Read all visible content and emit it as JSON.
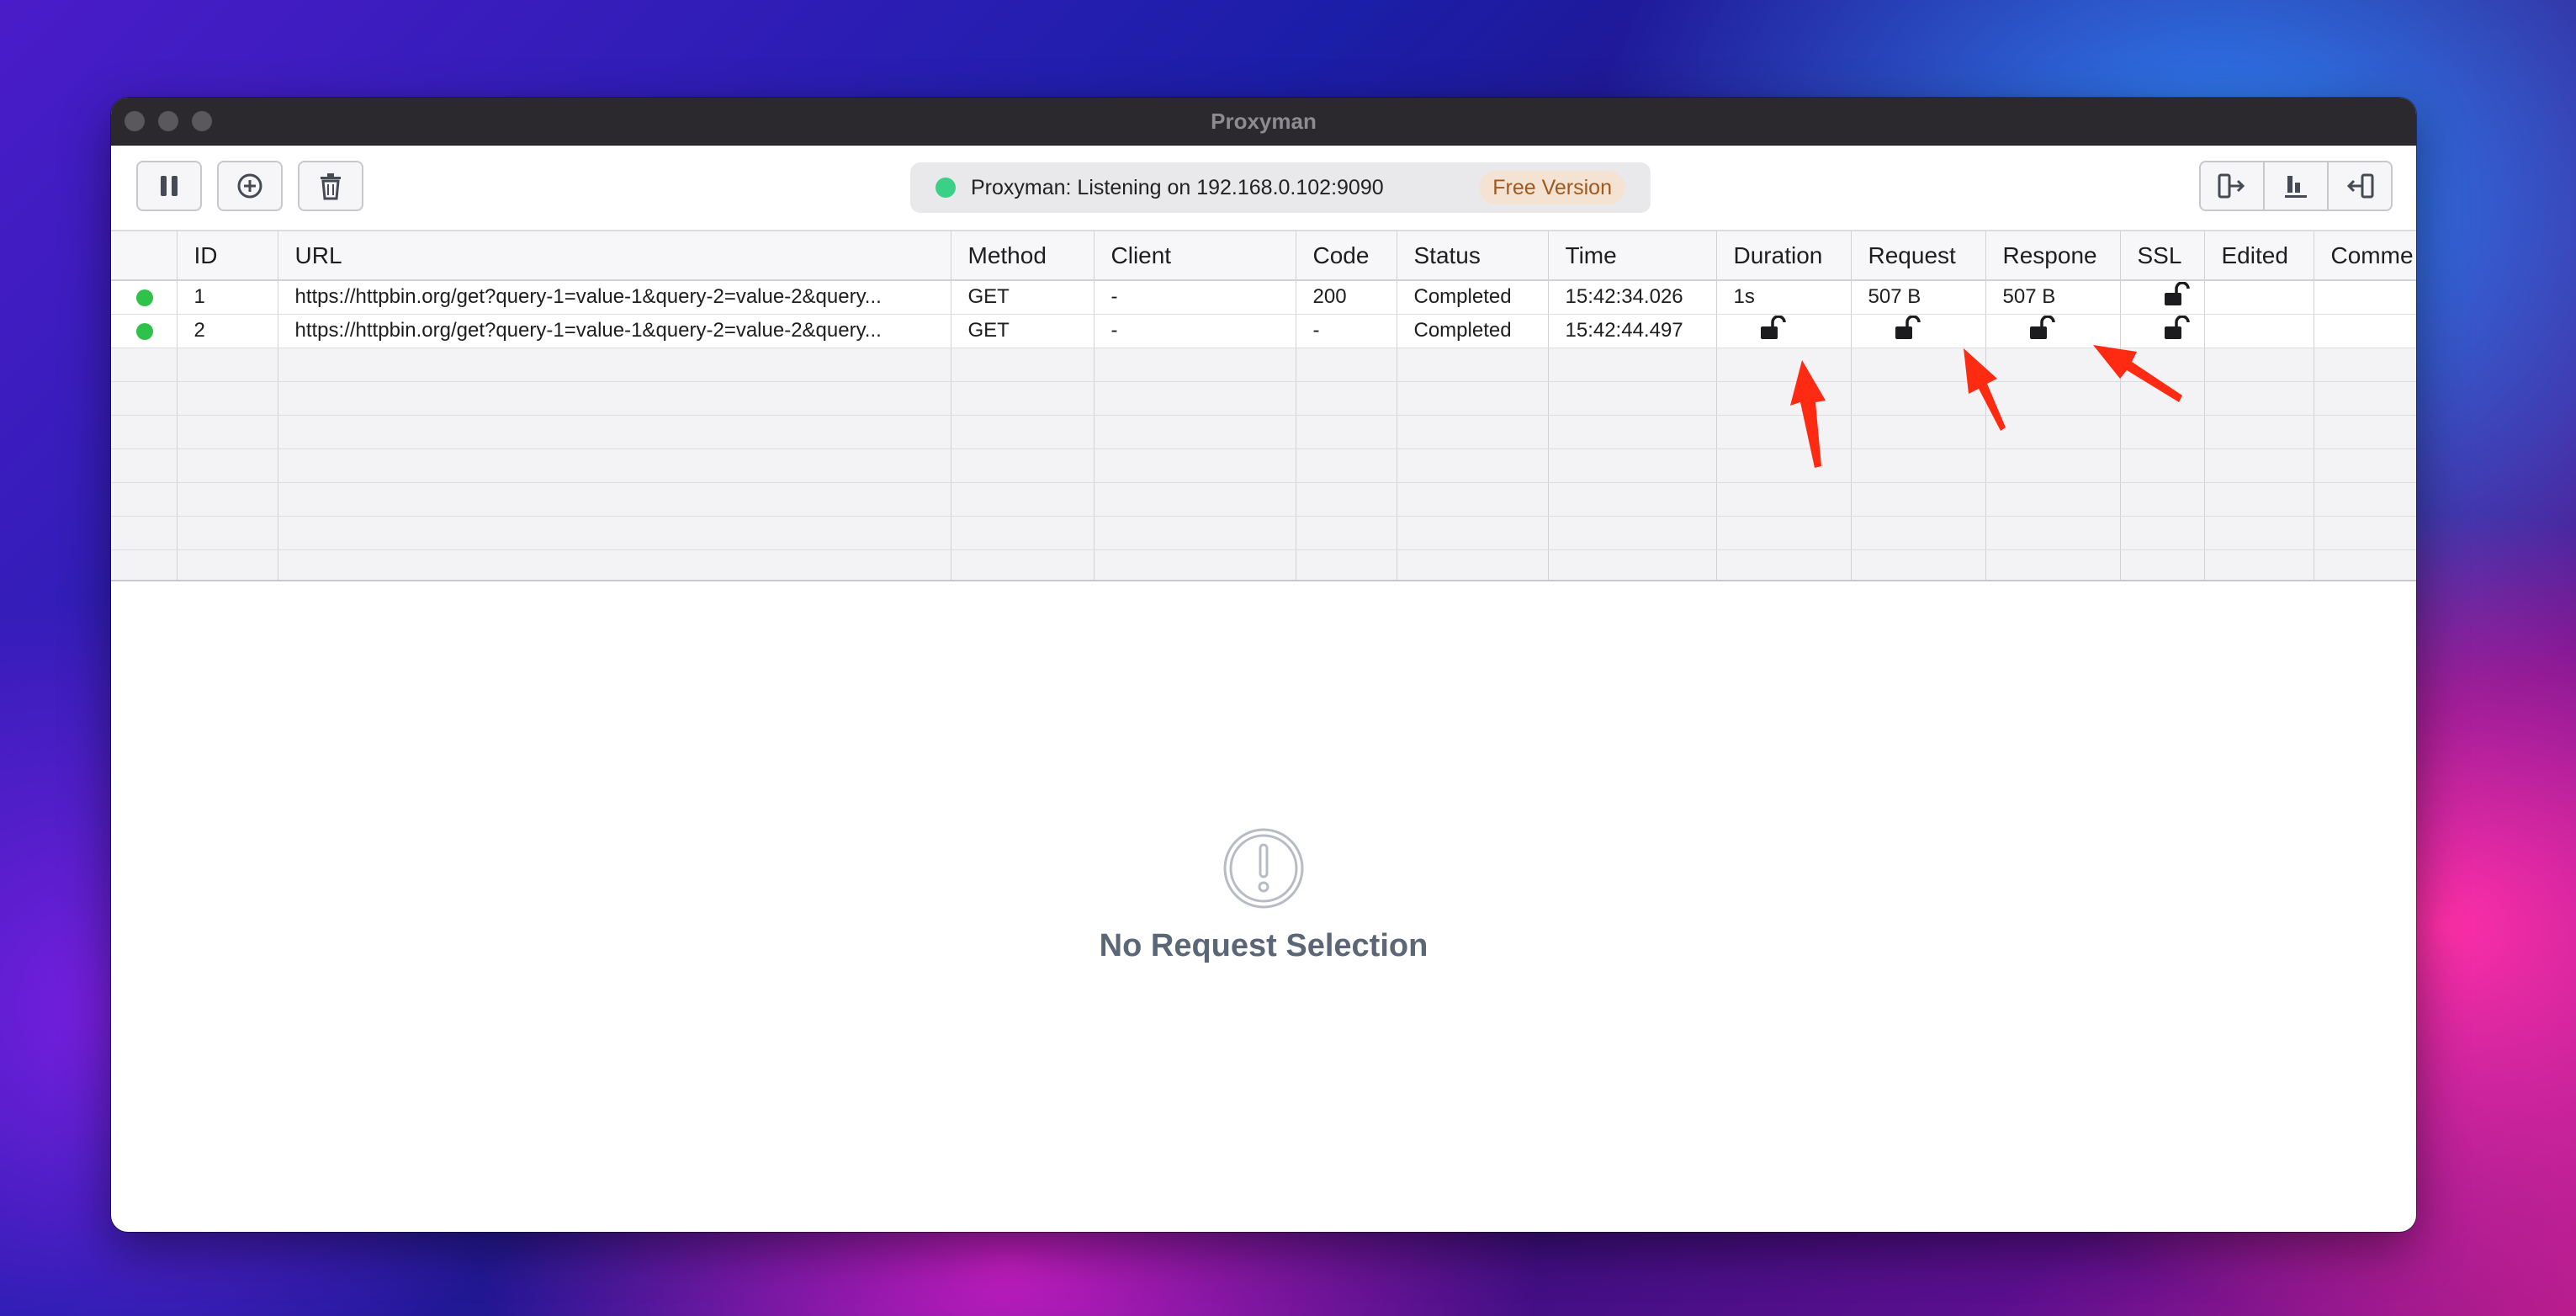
{
  "window": {
    "title": "Proxyman"
  },
  "toolbar": {
    "pause_icon": "pause-icon",
    "add_icon": "plus-circle-icon",
    "delete_icon": "trash-icon",
    "status": {
      "text": "Proxyman: Listening on 192.168.0.102:9090",
      "badge": "Free Version",
      "dot_color": "#3ad086"
    },
    "right_icons": [
      "export-icon",
      "chart-icon",
      "import-icon"
    ]
  },
  "table": {
    "columns": [
      "",
      "ID",
      "URL",
      "Method",
      "Client",
      "Code",
      "Status",
      "Time",
      "Duration",
      "Request",
      "Respone",
      "SSL",
      "Edited",
      "Comme"
    ],
    "rows": [
      {
        "id": "1",
        "url": "https://httpbin.org/get?query-1=value-1&query-2=value-2&query...",
        "method": "GET",
        "client": "-",
        "code": "200",
        "status": "Completed",
        "time": "15:42:34.026",
        "duration": "1s",
        "request": "507 B",
        "response": "507 B",
        "ssl": "unlocked-lock-icon"
      },
      {
        "id": "2",
        "url": "https://httpbin.org/get?query-1=value-1&query-2=value-2&query...",
        "method": "GET",
        "client": "-",
        "code": "-",
        "status": "Completed",
        "time": "15:42:44.497",
        "duration": "unlocked-lock-icon",
        "request": "unlocked-lock-icon",
        "response": "unlocked-lock-icon",
        "ssl": "unlocked-lock-icon"
      }
    ],
    "row_status_color": "#2fc24a"
  },
  "detail": {
    "empty_text": "No Request Selection",
    "icon": "exclamation-circle-icon"
  },
  "annotations": {
    "arrow_color": "#ff2a12",
    "arrow_icon": "red-arrow-icon"
  }
}
